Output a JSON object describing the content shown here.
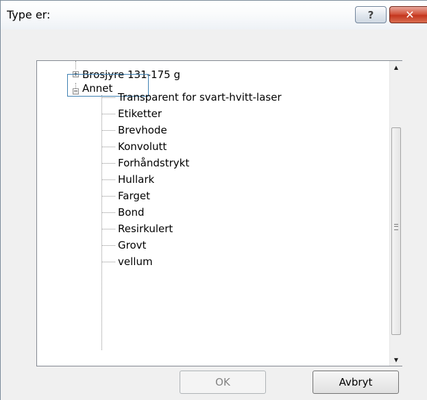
{
  "window": {
    "title": "Type er:",
    "help_label": "?",
    "close_label": "✕"
  },
  "tree": {
    "collapsed_parent": {
      "label": "Brosjyre 131-175 g",
      "expander": "+"
    },
    "expanded_parent": {
      "label": "Annet",
      "expander": "−",
      "selected": true
    },
    "children": [
      "Transparent for svart-hvitt-laser",
      "Etiketter",
      "Brevhode",
      "Konvolutt",
      "Forhåndstrykt",
      "Hullark",
      "Farget",
      "Bond",
      "Resirkulert",
      "Grovt",
      "vellum"
    ]
  },
  "scrollbar": {
    "up_icon": "▲",
    "down_icon": "▼"
  },
  "buttons": {
    "ok": "OK",
    "cancel": "Avbryt"
  },
  "colors": {
    "selection_border": "#3c7fb1",
    "close_button": "#c4361e"
  }
}
